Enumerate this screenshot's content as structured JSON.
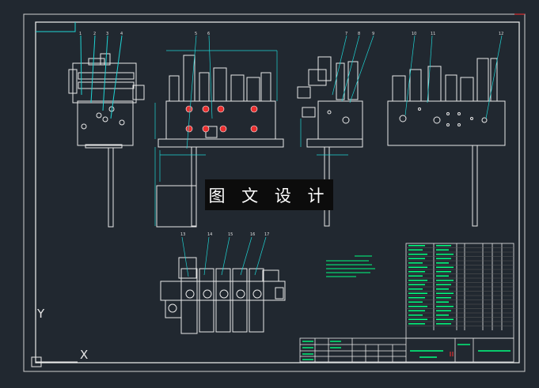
{
  "watermark": {
    "text": "图 文 设 计"
  },
  "axes": {
    "y_label": "Y",
    "x_label": "X"
  },
  "colors": {
    "background": "#212830",
    "linework": "#e8e8e8",
    "leaders": "#1fd3d3",
    "annotation": "#00ff7f",
    "frame": "#f2f2f2",
    "port_marks": "#e83030"
  },
  "views": [
    {
      "name": "front-view",
      "leader_labels": [
        "1",
        "2",
        "3",
        "4"
      ]
    },
    {
      "name": "side-view",
      "leader_labels": [
        "5",
        "6"
      ]
    },
    {
      "name": "rear-view",
      "leader_labels": [
        "7",
        "8",
        "9"
      ]
    },
    {
      "name": "section-view",
      "leader_labels": [
        "10",
        "11",
        "12"
      ]
    },
    {
      "name": "top-view",
      "leader_labels": [
        "13",
        "14",
        "15",
        "16",
        "17"
      ]
    }
  ]
}
